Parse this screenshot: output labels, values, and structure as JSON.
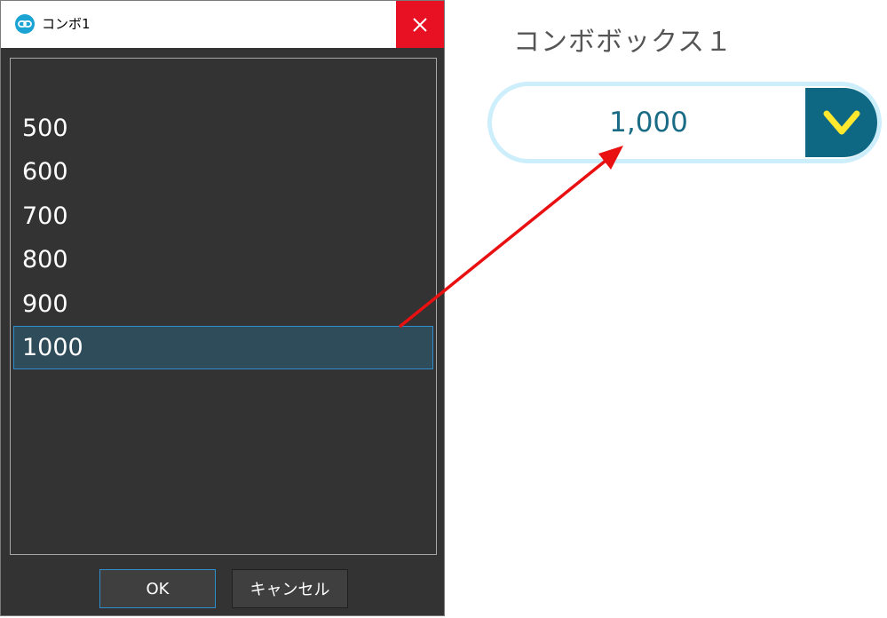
{
  "dialog": {
    "title": "コンボ1",
    "list_items": [
      "500",
      "600",
      "700",
      "800",
      "900",
      "1000"
    ],
    "selected_index": 5,
    "ok_label": "OK",
    "cancel_label": "キャンセル"
  },
  "widget": {
    "label": "コンボボックス１",
    "value": "1,000"
  },
  "colors": {
    "close": "#e81123",
    "accent": "#0e6884",
    "chevron": "#ffe82e",
    "arrow": "#e81010"
  },
  "icons": {
    "app": "link-icon",
    "close": "close-icon",
    "dropdown": "chevron-down-icon"
  }
}
